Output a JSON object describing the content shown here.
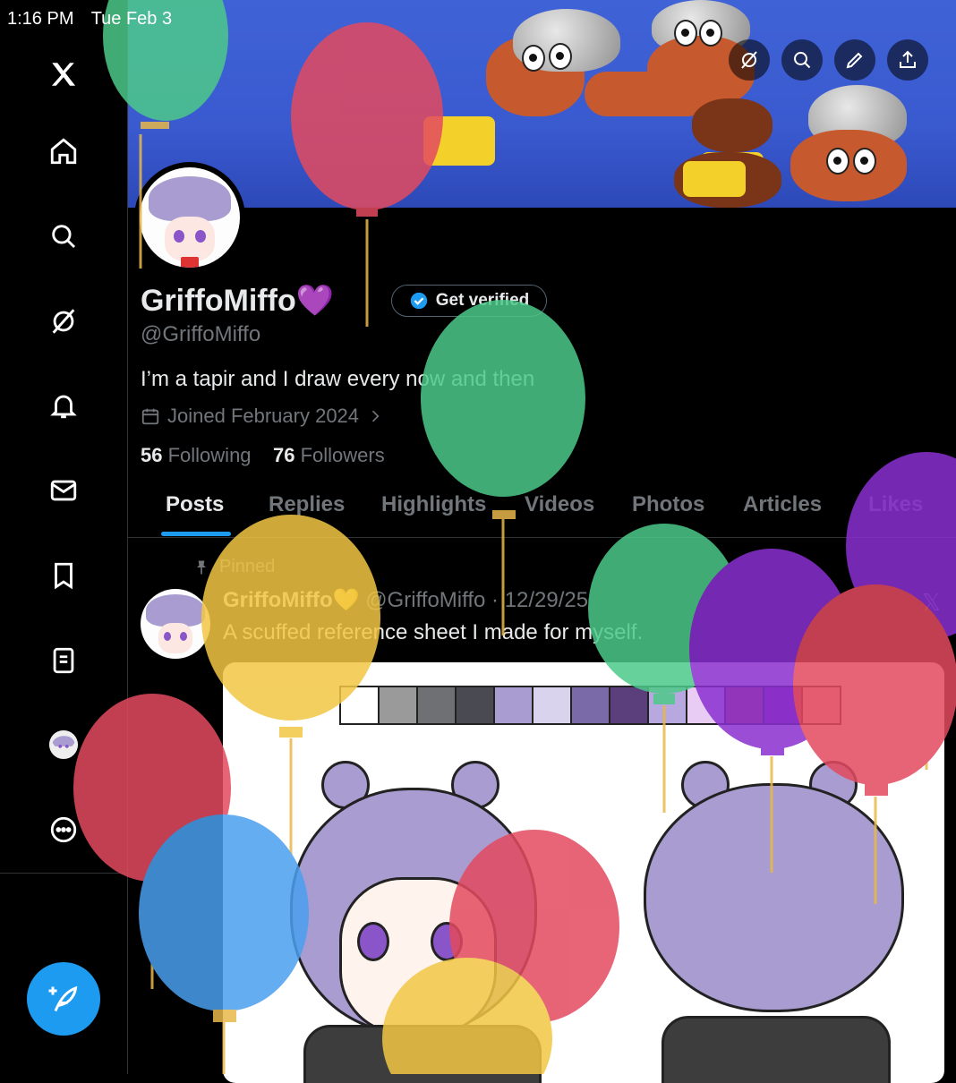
{
  "status_bar": {
    "time": "1:16 PM",
    "date": "Tue Feb 3"
  },
  "sidebar": {
    "items": [
      {
        "icon": "x-logo-icon"
      },
      {
        "icon": "home-icon"
      },
      {
        "icon": "search-icon"
      },
      {
        "icon": "grok-icon"
      },
      {
        "icon": "bell-icon"
      },
      {
        "icon": "mail-icon"
      },
      {
        "icon": "bookmark-icon"
      },
      {
        "icon": "lists-icon"
      },
      {
        "icon": "profile-avatar-icon"
      },
      {
        "icon": "more-icon"
      }
    ],
    "compose_icon": "feather-plus-icon"
  },
  "banner": {
    "buttons": [
      "grok-icon",
      "search-icon",
      "edit-icon",
      "share-icon"
    ]
  },
  "profile": {
    "display_name": "GriffoMiffo",
    "name_emoji": "💜",
    "get_verified_label": "Get verified",
    "handle": "@GriffoMiffo",
    "bio": "I’m a tapir and I draw every now and then",
    "joined": "Joined February 2024",
    "following_count": "56",
    "following_label": "Following",
    "followers_count": "76",
    "followers_label": "Followers"
  },
  "tabs": [
    "Posts",
    "Replies",
    "Highlights",
    "Videos",
    "Photos",
    "Articles",
    "Likes"
  ],
  "active_tab": "Posts",
  "pinned_post": {
    "pinned_label": "Pinned",
    "author": "GriffoMiffo",
    "author_emoji": "💛",
    "handle_date": "@GriffoMiffo · 12/29/25",
    "text": "A scuffed reference sheet I made for myself."
  },
  "colors": {
    "accent": "#1d9bf0",
    "background": "#000000",
    "text_primary": "#e7e9ea",
    "text_secondary": "#71767b",
    "swatches": [
      "#ffffff",
      "#9a9a9a",
      "#6f7074",
      "#4a4b52",
      "#a99cd0",
      "#d9d3ee",
      "#7a6aa8",
      "#5b3f7d",
      "#b8a8e0",
      "#e9ccf3",
      "#c95a3f",
      "#8f3aa0",
      "#f1c5d4"
    ]
  }
}
